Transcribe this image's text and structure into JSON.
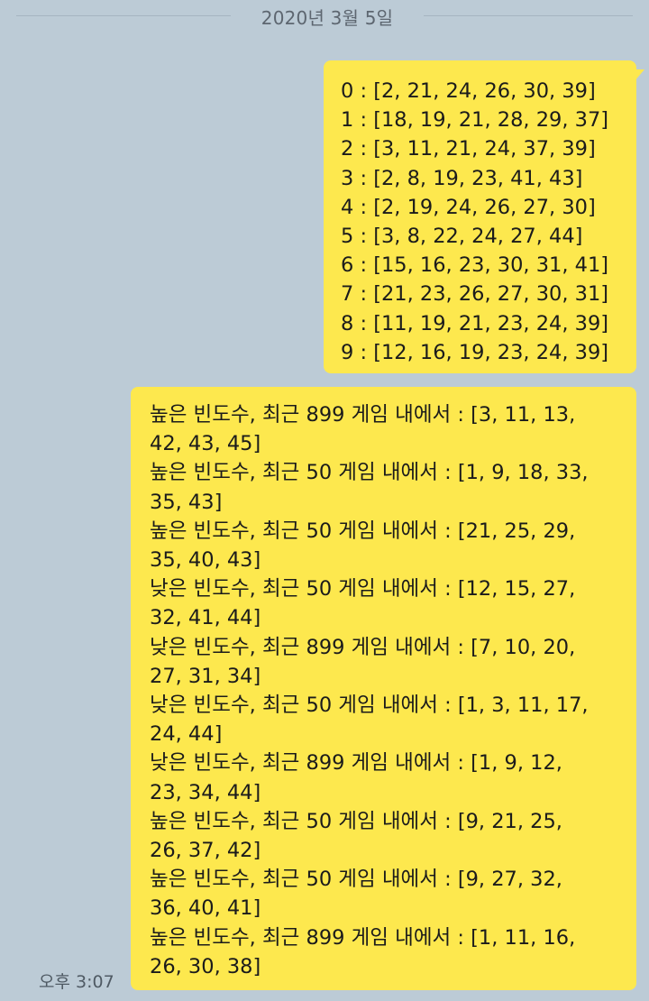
{
  "chat": {
    "date": "2020년 3월 5일",
    "timestamp": "오후 3:07",
    "colors": {
      "background": "#bccbd6",
      "bubble": "#fde84e"
    },
    "message1": {
      "lines": [
        "0 : [2, 21, 24, 26, 30, 39]",
        "1 : [18, 19, 21, 28, 29, 37]",
        "2 : [3, 11, 21, 24, 37, 39]",
        "3 : [2, 8, 19, 23, 41, 43]",
        "4 : [2, 19, 24, 26, 27, 30]",
        "5 : [3, 8, 22, 24, 27, 44]",
        "6 : [15, 16, 23, 30, 31, 41]",
        "7 : [21, 23, 26, 27, 30, 31]",
        "8 : [11, 19, 21, 23, 24, 39]",
        "9 : [12, 16, 19, 23, 24, 39]"
      ]
    },
    "message2": {
      "entries": [
        [
          "높은 빈도수, 최근 899 게임 내에서 : [3, 11, 13,",
          "42, 43, 45]"
        ],
        [
          "높은 빈도수, 최근 50 게임 내에서 : [1, 9, 18, 33,",
          "35, 43]"
        ],
        [
          "높은 빈도수, 최근 50 게임 내에서 : [21, 25, 29,",
          "35, 40, 43]"
        ],
        [
          "낮은 빈도수, 최근 50 게임 내에서 : [12, 15, 27,",
          "32, 41, 44]"
        ],
        [
          "낮은 빈도수, 최근 899 게임 내에서 : [7, 10, 20,",
          "27, 31, 34]"
        ],
        [
          "낮은 빈도수, 최근 50 게임 내에서 : [1, 3, 11, 17,",
          "24, 44]"
        ],
        [
          "낮은 빈도수, 최근 899 게임 내에서 : [1, 9, 12,",
          "23, 34, 44]"
        ],
        [
          "높은 빈도수, 최근 50 게임 내에서 : [9, 21, 25,",
          "26, 37, 42]"
        ],
        [
          "높은 빈도수, 최근 50 게임 내에서 : [9, 27, 32,",
          "36, 40, 41]"
        ],
        [
          "높은 빈도수, 최근 899 게임 내에서 : [1, 11, 16,",
          "26, 30, 38]"
        ]
      ]
    }
  }
}
